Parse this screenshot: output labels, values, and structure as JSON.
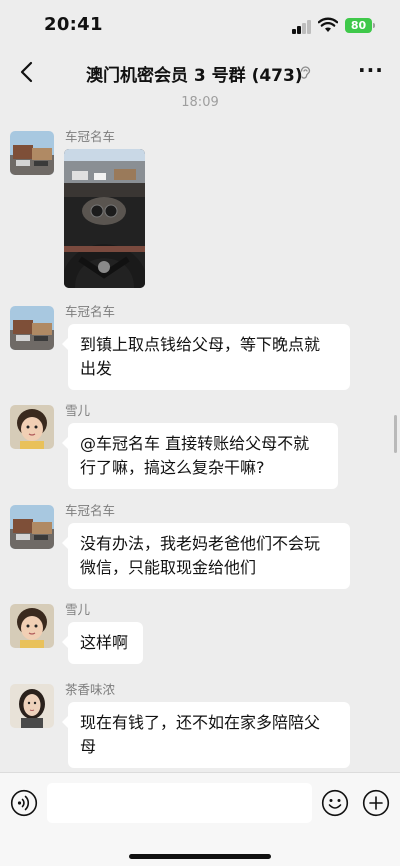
{
  "status_bar": {
    "time": "20:41",
    "battery": "80"
  },
  "nav": {
    "title": "澳门机密会员 3 号群 (473)"
  },
  "timestamp": "18:09",
  "messages": [
    {
      "sender": "车冠名车",
      "type": "image",
      "image_desc": "car interior photo"
    },
    {
      "sender": "车冠名车",
      "lines": [
        "到镇上取点钱给父母，等下晚点就",
        "出发"
      ]
    },
    {
      "sender": "雪儿",
      "lines": [
        "@车冠名车 直接转账给父母不就",
        "行了嘛，搞这么复杂干嘛?"
      ]
    },
    {
      "sender": "车冠名车",
      "lines": [
        "没有办法，我老妈老爸他们不会玩",
        "微信，只能取现金给他们"
      ]
    },
    {
      "sender": "雪儿",
      "lines": [
        "这样啊"
      ]
    },
    {
      "sender": "茶香味浓",
      "lines": [
        "现在有钱了，还不如在家多陪陪父",
        "母"
      ]
    }
  ],
  "colors": {
    "background": "#ededed",
    "bubble": "#ffffff",
    "battery": "#3fc84a",
    "meta_text": "#9e9e9e"
  },
  "icons": {
    "back": "chevron-left-icon",
    "mute": "ear-icon",
    "more": "more-dots-icon",
    "voice": "voice-icon",
    "emoji": "emoji-icon",
    "plus": "plus-icon"
  }
}
